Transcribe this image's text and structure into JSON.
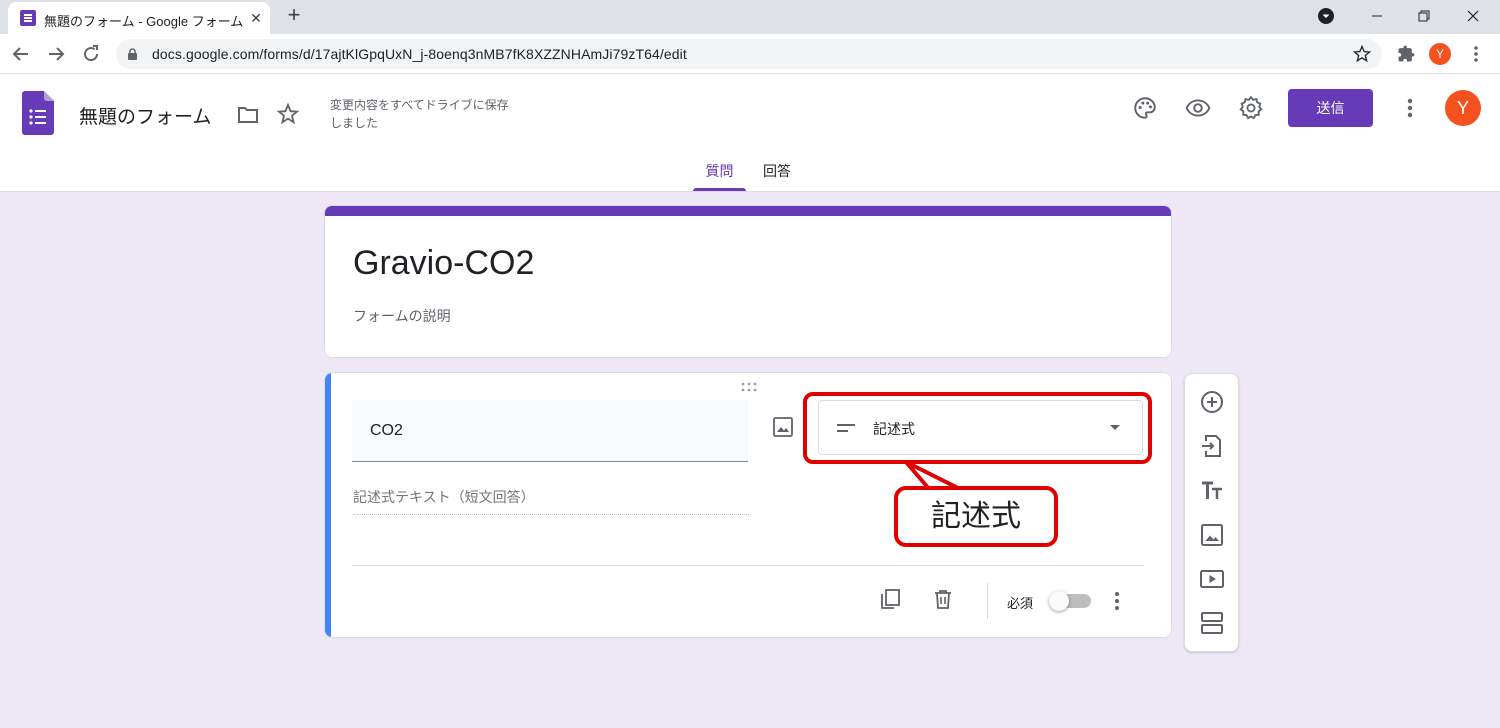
{
  "browser": {
    "tab_title": "無題のフォーム - Google フォーム",
    "tab_close": "✕",
    "new_tab": "+",
    "url": "docs.google.com/forms/d/17ajtKlGpqUxN_j-8oenq3nMB7fK8XZZNHAmJi79zT64/edit",
    "profile_initial": "Y"
  },
  "header": {
    "form_name": "無題のフォーム",
    "save_status": "変更内容をすべてドライブに保存しました",
    "send_label": "送信",
    "avatar_initial": "Y",
    "tabs": [
      {
        "label": "質問",
        "active": true
      },
      {
        "label": "回答",
        "active": false
      }
    ]
  },
  "form": {
    "title": "Gravio-CO2",
    "description_placeholder": "フォームの説明"
  },
  "question": {
    "title": "CO2",
    "type": "記述式",
    "answer_placeholder": "記述式テキスト（短文回答）",
    "required_label": "必須",
    "required": false
  },
  "annotation": {
    "callout_text": "記述式"
  },
  "colors": {
    "brand": "#673ab7",
    "accent_bar": "#4285f4",
    "annotation": "#e00000",
    "background": "#ede7f6"
  },
  "icons": {
    "header": [
      "palette-icon",
      "eye-icon",
      "gear-icon",
      "more-vert-icon"
    ],
    "side_toolbar": [
      "add-question-icon",
      "import-questions-icon",
      "add-title-icon",
      "add-image-icon",
      "add-video-icon",
      "add-section-icon"
    ],
    "question_footer": [
      "duplicate-icon",
      "delete-icon",
      "more-vert-icon"
    ]
  }
}
